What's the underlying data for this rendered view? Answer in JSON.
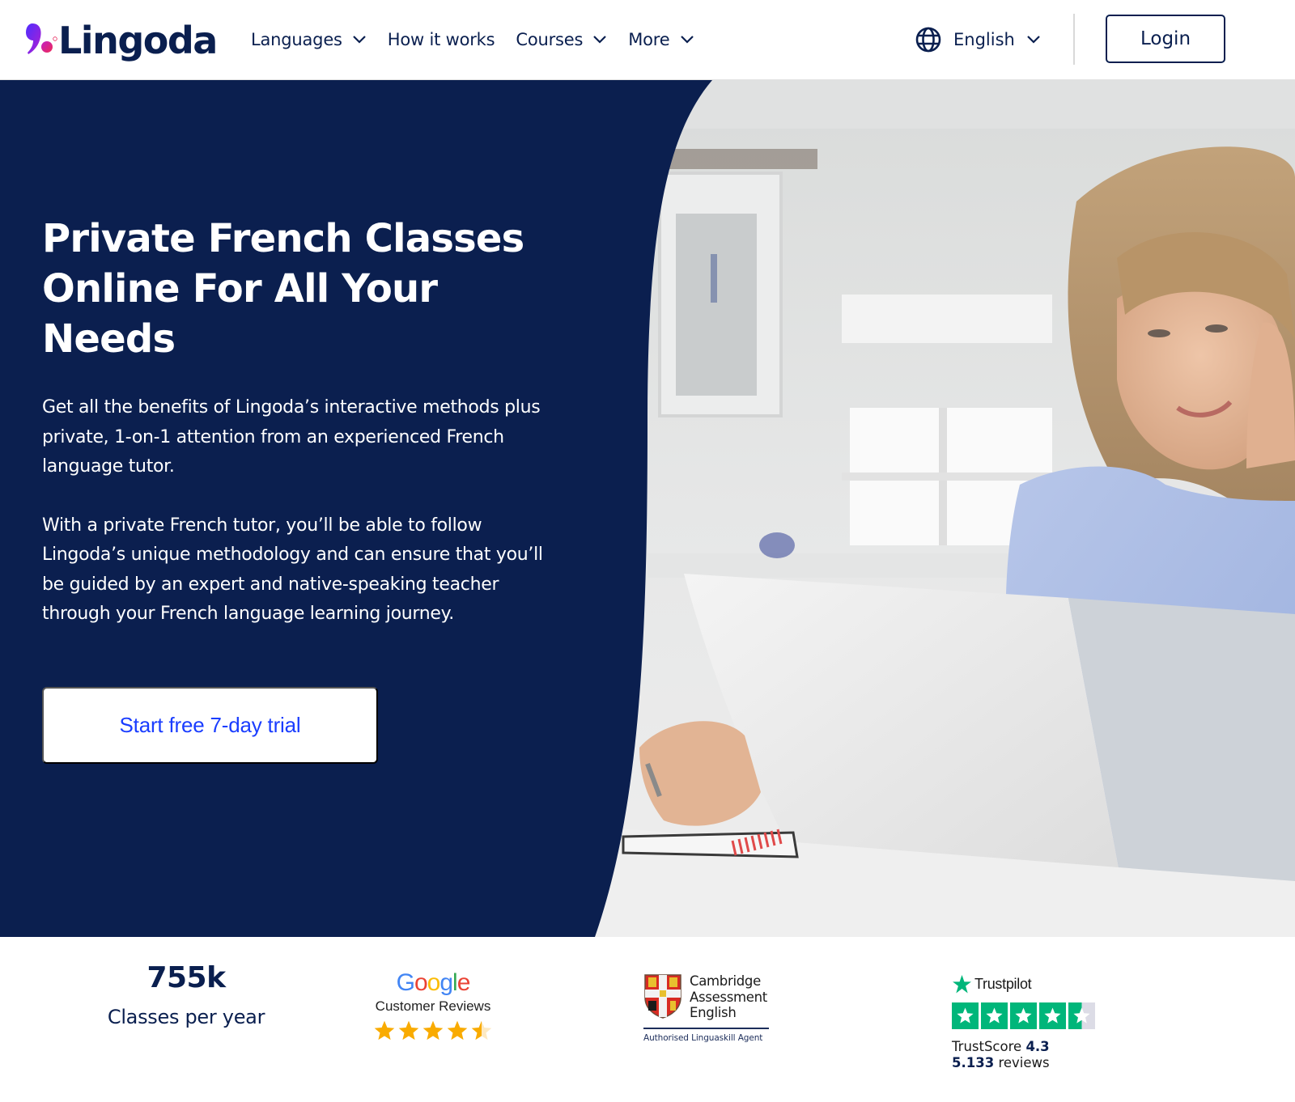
{
  "brand": {
    "name": "Lingoda",
    "colors": {
      "navy": "#0b1f4f",
      "cta_text": "#1a3dff",
      "logo_gradient_start": "#4f2dff",
      "logo_gradient_end": "#e8265c",
      "trustpilot_green": "#00b67a",
      "google_star": "#f9ab00"
    }
  },
  "header": {
    "nav": [
      {
        "label": "Languages",
        "has_dropdown": true
      },
      {
        "label": "How it works",
        "has_dropdown": false
      },
      {
        "label": "Courses",
        "has_dropdown": true
      },
      {
        "label": "More",
        "has_dropdown": true
      }
    ],
    "language": {
      "icon": "globe-icon",
      "label": "English"
    },
    "login_label": "Login"
  },
  "hero": {
    "title": "Private French Classes Online For All Your Needs",
    "paragraphs": [
      "Get all the benefits of Lingoda’s interactive methods plus private, 1-on-1 attention from an experienced French language tutor.",
      "With a private French tutor, you’ll be able to follow Lingoda’s unique methodology and can ensure that you’ll be guided by an expert and native-speaking teacher through your French language learning journey."
    ],
    "cta_label": "Start free 7-day trial",
    "image_description": "Woman smiling at a laptop in a bright kitchen, taking notes in a spiral notebook"
  },
  "trust_bar": {
    "stat": {
      "value": "755k",
      "label": "Classes per year"
    },
    "google": {
      "letters": [
        {
          "ch": "G",
          "color": "#4285f4"
        },
        {
          "ch": "o",
          "color": "#ea4335"
        },
        {
          "ch": "o",
          "color": "#fbbc05"
        },
        {
          "ch": "g",
          "color": "#4285f4"
        },
        {
          "ch": "l",
          "color": "#34a853"
        },
        {
          "ch": "e",
          "color": "#ea4335"
        }
      ],
      "subtitle": "Customer Reviews",
      "rating": 4.5,
      "max_rating": 5
    },
    "cambridge": {
      "name_lines": [
        "Cambridge",
        "Assessment",
        "English"
      ],
      "subtitle": "Authorised Linguaskill Agent"
    },
    "trustpilot": {
      "brand": "Trustpilot",
      "rating": 4.5,
      "max_rating": 5,
      "score_label": "TrustScore",
      "score": "4.3",
      "reviews_count": "5.133",
      "reviews_label": "reviews"
    }
  }
}
